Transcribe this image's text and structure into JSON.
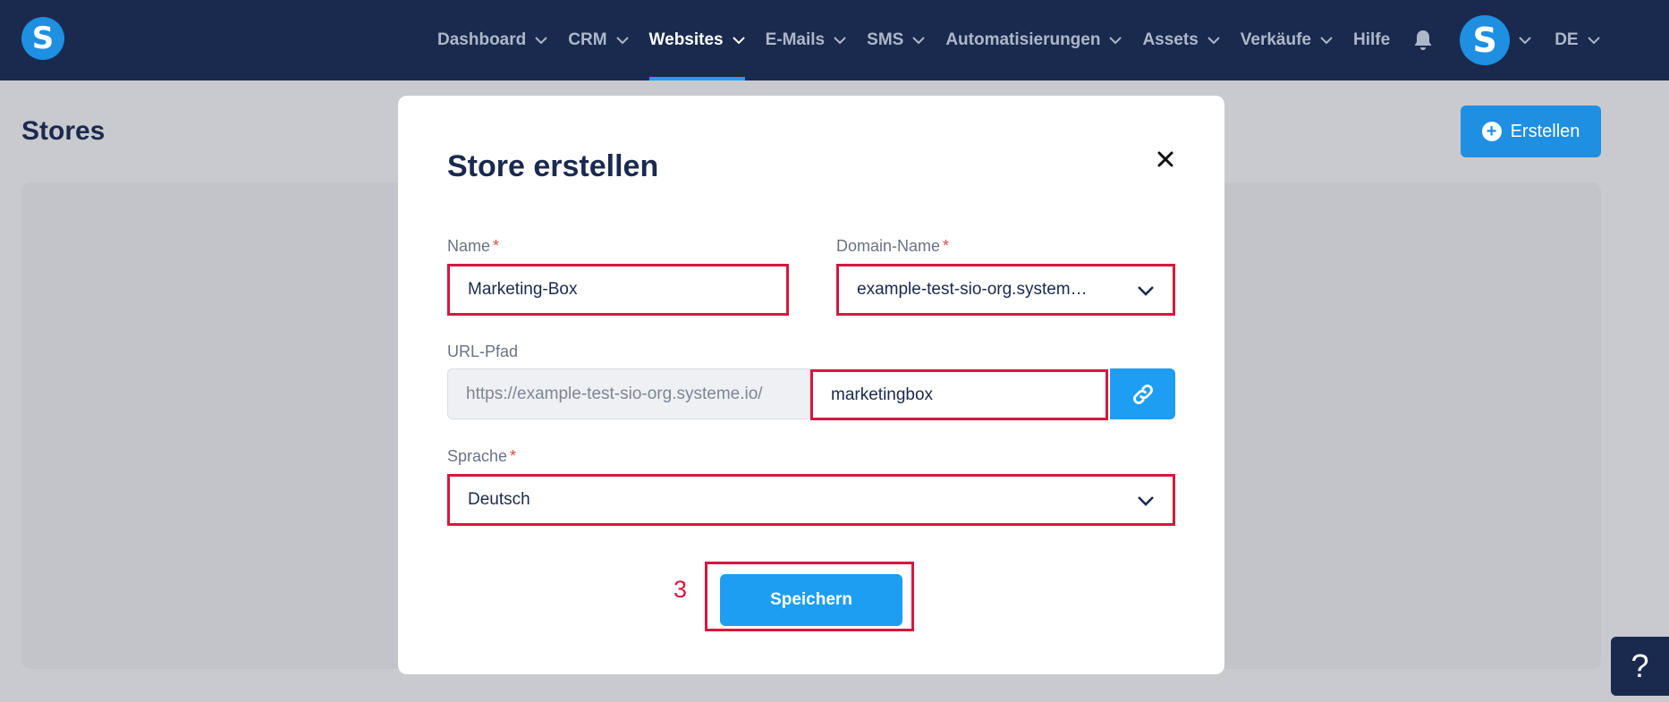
{
  "brand": {
    "logo_letter": "S"
  },
  "nav": {
    "items": [
      {
        "label": "Dashboard",
        "has_dropdown": true,
        "active": false
      },
      {
        "label": "CRM",
        "has_dropdown": true,
        "active": false
      },
      {
        "label": "Websites",
        "has_dropdown": true,
        "active": true
      },
      {
        "label": "E-Mails",
        "has_dropdown": true,
        "active": false
      },
      {
        "label": "SMS",
        "has_dropdown": true,
        "active": false
      },
      {
        "label": "Automatisierungen",
        "has_dropdown": true,
        "active": false
      },
      {
        "label": "Assets",
        "has_dropdown": true,
        "active": false
      },
      {
        "label": "Verkäufe",
        "has_dropdown": true,
        "active": false
      },
      {
        "label": "Hilfe",
        "has_dropdown": false,
        "active": false
      }
    ],
    "avatar_letter": "S",
    "language": "DE"
  },
  "page": {
    "title": "Stores",
    "create_button_label": "Erstellen",
    "help_label": "?"
  },
  "modal": {
    "title": "Store erstellen",
    "name_label": "Name",
    "name_value": "Marketing-Box",
    "domain_label": "Domain-Name",
    "domain_value": "example-test-sio-org.system…",
    "url_label": "URL-Pfad",
    "url_prefix": "https://example-test-sio-org.systeme.io/",
    "url_path_value": "marketingbox",
    "language_label": "Sprache",
    "language_value": "Deutsch",
    "required_marker": "*",
    "save_label": "Speichern",
    "step_number": "3"
  },
  "colors": {
    "navbar": "#1a2a4e",
    "accent": "#1e9ef2",
    "highlight": "#d6173f",
    "required": "#e04b4b"
  }
}
